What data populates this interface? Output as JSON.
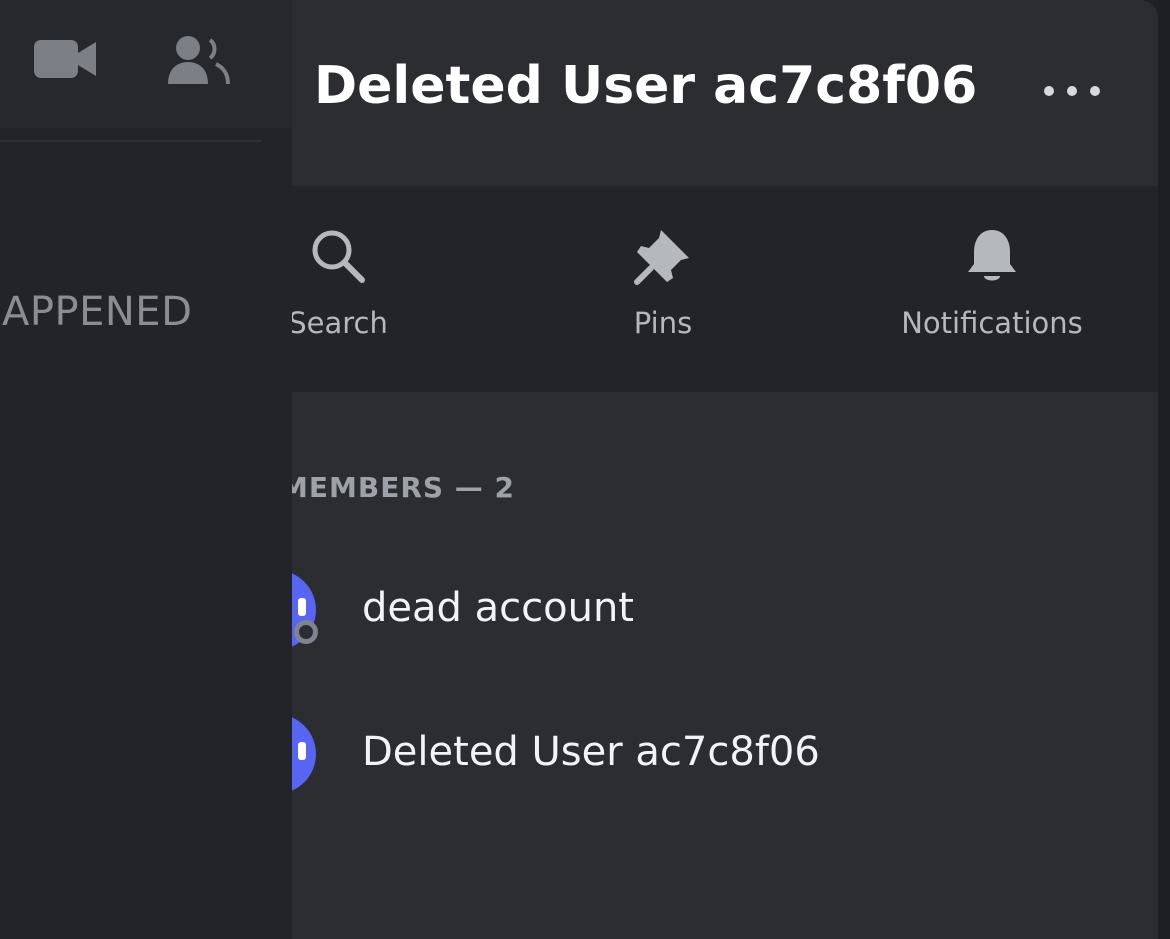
{
  "left_panel": {
    "icons": [
      "video-camera-icon",
      "people-icon"
    ],
    "section_text": "APPENED"
  },
  "header": {
    "title": "Deleted User ac7c8f06",
    "more_icon": "ellipsis-icon"
  },
  "actions": [
    {
      "label": "Search",
      "icon": "search-icon"
    },
    {
      "label": "Pins",
      "icon": "pin-icon"
    },
    {
      "label": "Notifications",
      "icon": "bell-icon"
    }
  ],
  "members": {
    "title": "MEMBERS — 2",
    "list": [
      {
        "name": "dead account",
        "status": "offline"
      },
      {
        "name": "Deleted User ac7c8f06",
        "status": ""
      }
    ]
  },
  "colors": {
    "avatar": "#5865f2",
    "panel": "#2b2d31",
    "background": "#232428"
  }
}
